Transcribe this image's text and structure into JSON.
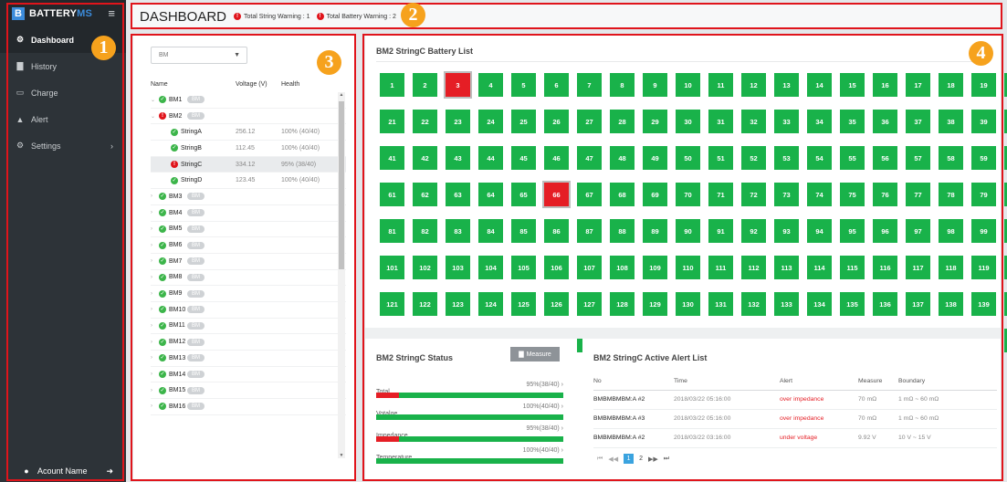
{
  "brand": {
    "logo": "B",
    "name_a": "BATTERY",
    "name_b": "MS"
  },
  "sidebar": {
    "items": [
      {
        "label": "Dashboard",
        "icon": "dashboard-icon",
        "glyph": "⚙",
        "active": true
      },
      {
        "label": "History",
        "icon": "bar-chart-icon",
        "glyph": "▇",
        "active": false
      },
      {
        "label": "Charge",
        "icon": "battery-icon",
        "glyph": "▭",
        "active": false
      },
      {
        "label": "Alert",
        "icon": "warning-icon",
        "glyph": "▲",
        "active": false
      },
      {
        "label": "Settings",
        "icon": "gear-icon",
        "glyph": "⚙",
        "active": false,
        "chevron": "›"
      }
    ],
    "account": "Acount Name"
  },
  "header": {
    "title": "DASHBOARD",
    "warn_string": "Total String Warning : 1",
    "warn_battery": "Total Battery Warning : 2"
  },
  "markers": [
    "1",
    "2",
    "3",
    "4"
  ],
  "tree": {
    "select_value": "BM",
    "col_name": "Name",
    "col_voltage": "Voltage (V)",
    "col_health": "Health",
    "pill": "BM",
    "rows": [
      {
        "type": "bm",
        "name": "BM1",
        "status": "ok",
        "open": true
      },
      {
        "type": "bm",
        "name": "BM2",
        "status": "bad",
        "open": true
      },
      {
        "type": "string",
        "name": "StringA",
        "status": "ok",
        "voltage": "256.12",
        "health": "100% (40/40)"
      },
      {
        "type": "string",
        "name": "StringB",
        "status": "ok",
        "voltage": "112.45",
        "health": "100% (40/40)"
      },
      {
        "type": "string",
        "name": "StringC",
        "status": "bad",
        "voltage": "334.12",
        "health": "95% (38/40)",
        "selected": true
      },
      {
        "type": "string",
        "name": "StringD",
        "status": "ok",
        "voltage": "123.45",
        "health": "100% (40/40)"
      },
      {
        "type": "bm",
        "name": "BM3",
        "status": "ok"
      },
      {
        "type": "bm",
        "name": "BM4",
        "status": "ok"
      },
      {
        "type": "bm",
        "name": "BM5",
        "status": "ok"
      },
      {
        "type": "bm",
        "name": "BM6",
        "status": "ok"
      },
      {
        "type": "bm",
        "name": "BM7",
        "status": "ok"
      },
      {
        "type": "bm",
        "name": "BM8",
        "status": "ok"
      },
      {
        "type": "bm",
        "name": "BM9",
        "status": "ok"
      },
      {
        "type": "bm",
        "name": "BM10",
        "status": "ok"
      },
      {
        "type": "bm",
        "name": "BM11",
        "status": "ok"
      },
      {
        "type": "bm",
        "name": "BM12",
        "status": "ok"
      },
      {
        "type": "bm",
        "name": "BM13",
        "status": "ok"
      },
      {
        "type": "bm",
        "name": "BM14",
        "status": "ok"
      },
      {
        "type": "bm",
        "name": "BM15",
        "status": "ok"
      },
      {
        "type": "bm",
        "name": "BM16",
        "status": "ok"
      }
    ]
  },
  "battery_list": {
    "title": "BM2 StringC  Battery List",
    "count": 160,
    "alert_cells": [
      3,
      66
    ],
    "colors": {
      "ok": "#19b24a",
      "alert": "#e51e25"
    }
  },
  "status": {
    "title": "BM2 StringC Status",
    "measure_label": "Measure",
    "rows": [
      {
        "label": "Total",
        "value": "95%(38/40)",
        "red_fraction": 0.12
      },
      {
        "label": "Votalge",
        "value": "100%(40/40)",
        "red_fraction": 0
      },
      {
        "label": "Impedance",
        "value": "95%(38/40)",
        "red_fraction": 0.12
      },
      {
        "label": "Temperature",
        "value": "100%(40/40)",
        "red_fraction": 0
      }
    ]
  },
  "alerts": {
    "title": "BM2 StringC Active Alert List",
    "headers": [
      "No",
      "Time",
      "Alert",
      "Measure",
      "Boundary"
    ],
    "rows": [
      [
        "BMBMBMBM:A #2",
        "2018/03/22 05:16:00",
        "over impedance",
        "70 mΩ",
        "1 mΩ ~ 60 mΩ"
      ],
      [
        "BMBMBMBM:A #3",
        "2018/03/22 05:16:00",
        "over impedance",
        "70 mΩ",
        "1 mΩ ~ 60 mΩ"
      ],
      [
        "BMBMBMBM:A #2",
        "2018/03/22 03:16:00",
        "under voltage",
        "9.92 V",
        "10 V ~ 15 V"
      ]
    ],
    "pager": {
      "current": "1",
      "next": "2"
    }
  }
}
